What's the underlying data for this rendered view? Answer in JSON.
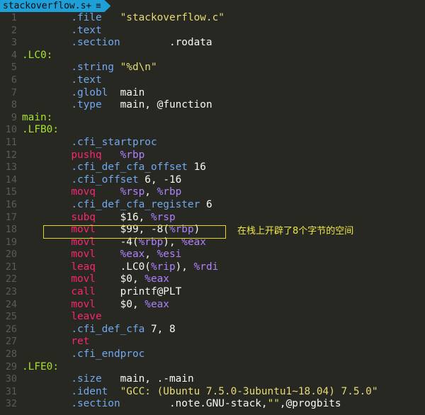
{
  "tab": {
    "filename": "stackoverflow.s+",
    "menu_icon": "≡"
  },
  "annotation": {
    "text": "在栈上开辟了8个字节的空间"
  },
  "lines": [
    {
      "n": "1",
      "text": "        .file   \"stackoverflow.c\""
    },
    {
      "n": "2",
      "text": "        .text"
    },
    {
      "n": "3",
      "text": "        .section        .rodata"
    },
    {
      "n": "4",
      "text": ".LC0:"
    },
    {
      "n": "5",
      "text": "        .string \"%d\\n\""
    },
    {
      "n": "6",
      "text": "        .text"
    },
    {
      "n": "7",
      "text": "        .globl  main"
    },
    {
      "n": "8",
      "text": "        .type   main, @function"
    },
    {
      "n": "9",
      "text": "main:"
    },
    {
      "n": "10",
      "text": ".LFB0:"
    },
    {
      "n": "11",
      "text": "        .cfi_startproc"
    },
    {
      "n": "12",
      "text": "        pushq   %rbp"
    },
    {
      "n": "13",
      "text": "        .cfi_def_cfa_offset 16"
    },
    {
      "n": "14",
      "text": "        .cfi_offset 6, -16"
    },
    {
      "n": "15",
      "text": "        movq    %rsp, %rbp"
    },
    {
      "n": "16",
      "text": "        .cfi_def_cfa_register 6"
    },
    {
      "n": "17",
      "text": "        subq    $16, %rsp"
    },
    {
      "n": "18",
      "text": "        movl    $99, -8(%rbp)"
    },
    {
      "n": "19",
      "text": "        movl    -4(%rbp), %eax"
    },
    {
      "n": "20",
      "text": "        movl    %eax, %esi"
    },
    {
      "n": "21",
      "text": "        leaq    .LC0(%rip), %rdi"
    },
    {
      "n": "22",
      "text": "        movl    $0, %eax"
    },
    {
      "n": "23",
      "text": "        call    printf@PLT"
    },
    {
      "n": "24",
      "text": "        movl    $0, %eax"
    },
    {
      "n": "25",
      "text": "        leave"
    },
    {
      "n": "26",
      "text": "        .cfi_def_cfa 7, 8"
    },
    {
      "n": "27",
      "text": "        ret"
    },
    {
      "n": "28",
      "text": "        .cfi_endproc"
    },
    {
      "n": "29",
      "text": ".LFE0:"
    },
    {
      "n": "30",
      "text": "        .size   main, .-main"
    },
    {
      "n": "31",
      "text": "        .ident  \"GCC: (Ubuntu 7.5.0-3ubuntu1~18.04) 7.5.0\""
    },
    {
      "n": "32",
      "text": "        .section        .note.GNU-stack,\"\",@progbits"
    }
  ]
}
